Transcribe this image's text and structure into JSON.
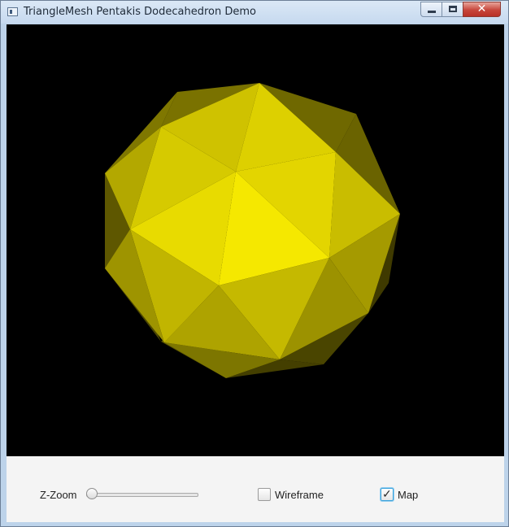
{
  "window": {
    "title": "TriangleMesh Pentakis Dodecahedron Demo",
    "icon": "java-app-icon",
    "controls": {
      "minimize": "minimize-icon",
      "maximize": "maximize-icon",
      "close": "✕"
    }
  },
  "scene": {
    "shape": "pentakis dodecahedron",
    "background_color": "#000000",
    "material_color": "#ffee00"
  },
  "controls": {
    "zoom": {
      "label": "Z-Zoom",
      "value": 0
    },
    "wireframe": {
      "label": "Wireframe",
      "checked": false
    },
    "map": {
      "label": "Map",
      "checked": true,
      "check_glyph": "✓"
    }
  }
}
